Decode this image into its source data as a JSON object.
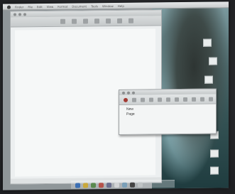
{
  "menubar": {
    "items": [
      "Finder",
      "File",
      "Edit",
      "View",
      "Format",
      "Document",
      "Tools",
      "Window",
      "Help"
    ]
  },
  "small_window": {
    "lines": [
      "New",
      "Page"
    ]
  },
  "dock": {
    "icons": [
      "finder-icon",
      "browser-icon",
      "mail-icon",
      "app-icon",
      "app-icon",
      "app-icon",
      "app-icon",
      "app-icon",
      "trash-icon"
    ],
    "colors": [
      "#3c6fb3",
      "#c9a83c",
      "#5a8a4f",
      "#b5524a",
      "#6b6f8f",
      "#d2d4d6",
      "#7a9fb8",
      "#444",
      "#bfc3c5"
    ]
  }
}
